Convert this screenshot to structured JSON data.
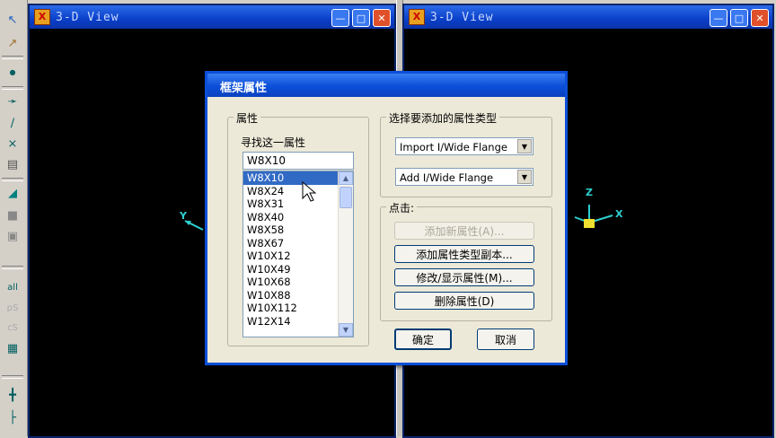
{
  "views": {
    "left": {
      "title": "3-D View"
    },
    "right": {
      "title": "3-D View"
    }
  },
  "axes": {
    "left_y": "Y",
    "right_z": "Z",
    "right_x": "X"
  },
  "dialog": {
    "title": "框架属性",
    "properties_group": {
      "legend": "属性",
      "find_label": "寻找这一属性",
      "find_value": "W8X10",
      "list": [
        "W8X10",
        "W8X24",
        "W8X31",
        "W8X40",
        "W8X58",
        "W8X67",
        "W10X12",
        "W10X49",
        "W10X68",
        "W10X88",
        "W10X112",
        "W12X14"
      ],
      "selected_index": 0
    },
    "type_group": {
      "legend": "选择要添加的属性类型",
      "import_value": "Import I/Wide Flange",
      "add_value": "Add I/Wide Flange"
    },
    "click_group": {
      "legend": "点击:",
      "add_new": "添加新属性(A)...",
      "add_copy": "添加属性类型副本...",
      "modify": "修改/显示属性(M)...",
      "delete": "删除属性(D)"
    },
    "ok_label": "确定",
    "cancel_label": "取消"
  },
  "colors": {
    "titlebar": "#0b4ed8",
    "selection": "#316ac5",
    "axis": "#2ed0d0"
  }
}
